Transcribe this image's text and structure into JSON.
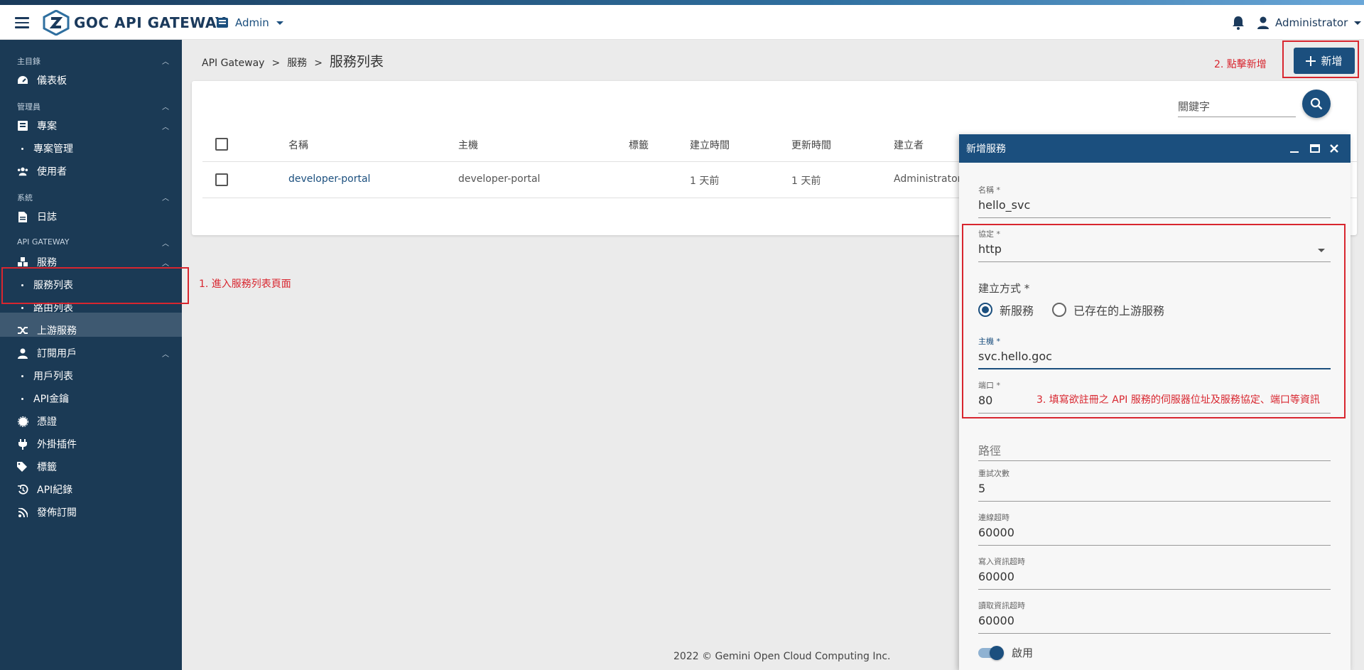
{
  "header": {
    "brand": "GOC API GATEWAY",
    "admin_menu": "Admin",
    "user": "Administrator"
  },
  "sidebar": {
    "sections": {
      "main": "主目錄",
      "admin": "管理員",
      "system": "系統",
      "gateway": "API GATEWAY"
    },
    "items": {
      "dashboard": "儀表板",
      "projects": "專案",
      "project_manage": "專案管理",
      "users": "使用者",
      "logs": "日誌",
      "services": "服務",
      "service_list": "服務列表",
      "route_list": "路由列表",
      "upstream": "上游服務",
      "subscribers": "訂閱用戶",
      "user_list": "用戶列表",
      "api_keys": "API金鑰",
      "certs": "憑證",
      "plugins": "外掛插件",
      "tags": "標籤",
      "api_records": "API紀錄",
      "pubsub": "發佈訂閱"
    }
  },
  "breadcrumb": {
    "root": "API Gateway",
    "sep": ">",
    "mid": "服務",
    "current": "服務列表"
  },
  "toolbar": {
    "add_label": "新增",
    "keyword_placeholder": "關鍵字"
  },
  "table": {
    "columns": [
      "名稱",
      "主機",
      "標籤",
      "建立時間",
      "更新時間",
      "建立者"
    ],
    "rows": [
      {
        "name": "developer-portal",
        "host": "developer-portal",
        "tags": "",
        "created": "1 天前",
        "updated": "1 天前",
        "creator": "Administrator"
      }
    ]
  },
  "dialog": {
    "title": "新增服務",
    "name_label": "名稱 *",
    "name_value": "hello_svc",
    "protocol_label": "協定 *",
    "protocol_value": "http",
    "create_mode_label": "建立方式 *",
    "create_mode_options": [
      "新服務",
      "已存在的上游服務"
    ],
    "create_mode_selected": "新服務",
    "host_label": "主機 *",
    "host_value": "svc.hello.goc",
    "port_label": "端口 *",
    "port_value": "80",
    "path_placeholder": "路徑",
    "retries_label": "重試次數",
    "retries_value": "5",
    "connect_timeout_label": "連線超時",
    "connect_timeout_value": "60000",
    "write_timeout_label": "寫入資訊超時",
    "write_timeout_value": "60000",
    "read_timeout_label": "讀取資訊超時",
    "read_timeout_value": "60000",
    "enabled_label": "啟用",
    "enabled": true
  },
  "annotations": {
    "step1": "1. 進入服務列表頁面",
    "step2": "2. 點擊新增",
    "step3": "3. 填寫欲註冊之 API 服務的伺服器位址及服務協定、端口等資訊"
  },
  "footer": "2022 © Gemini Open Cloud Computing Inc.",
  "colors": {
    "primary": "#1b4f7e",
    "sidebar_bg": "#1b3a55",
    "annotation_red": "#d8262f"
  }
}
